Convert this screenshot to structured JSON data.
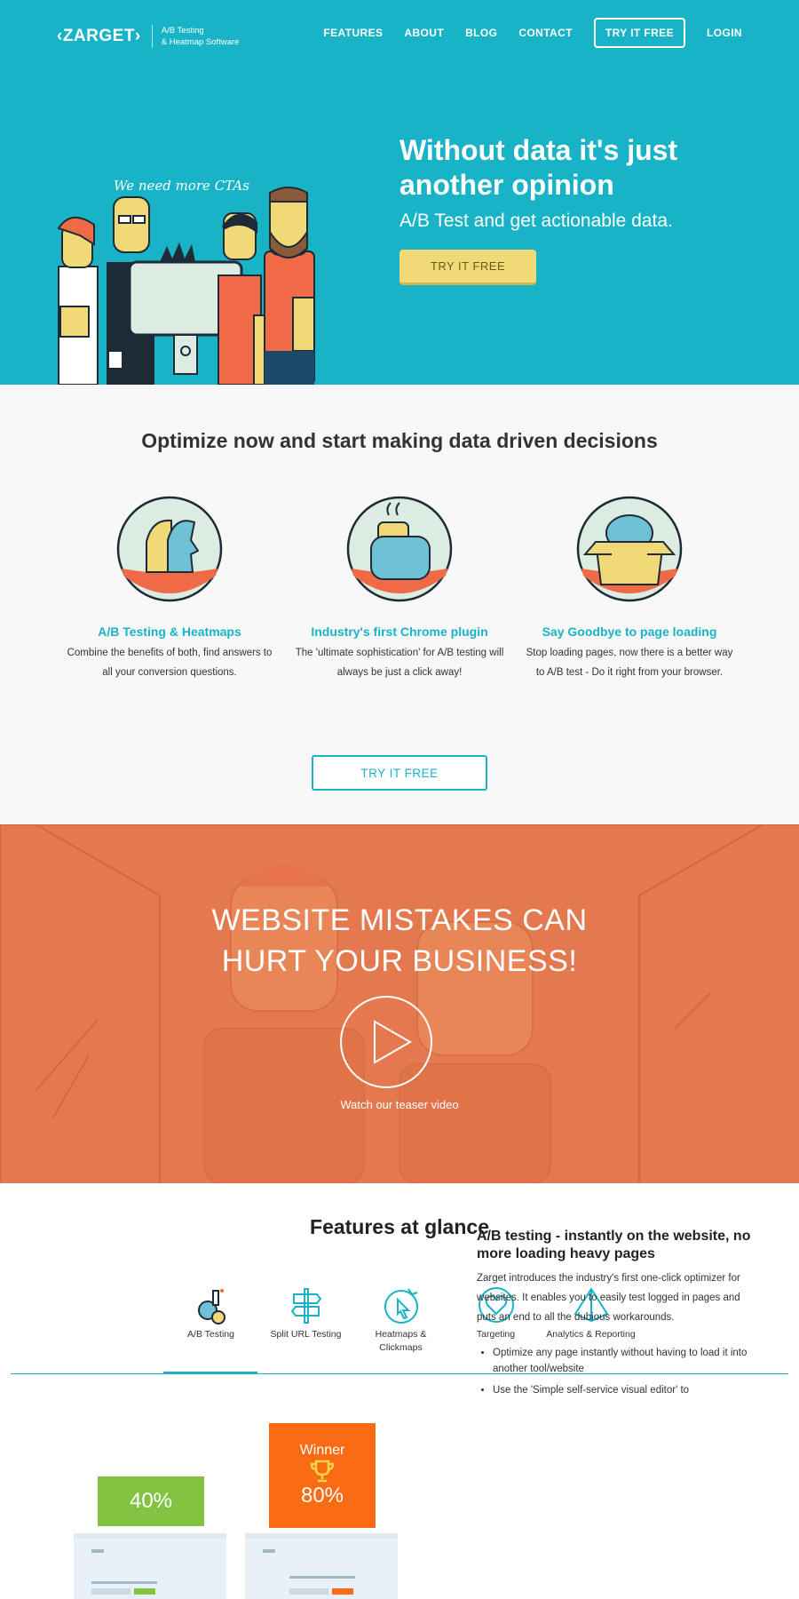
{
  "header": {
    "logo": "‹ZARGET›",
    "tagline_line1": "A/B Testing",
    "tagline_line2": "& Heatmap Software",
    "nav": [
      {
        "label": "FEATURES"
      },
      {
        "label": "ABOUT"
      },
      {
        "label": "BLOG"
      },
      {
        "label": "CONTACT"
      },
      {
        "label": "TRY IT FREE"
      },
      {
        "label": "LOGIN"
      }
    ]
  },
  "hero": {
    "title": "Without data it's just another opinion",
    "subtitle": "A/B Test and get actionable data.",
    "cta": "TRY IT FREE",
    "speech": "We need more CTAs"
  },
  "optimize": {
    "title": "Optimize now and start making data driven decisions",
    "features": [
      {
        "title": "A/B Testing & Heatmaps",
        "text": "Combine the benefits of both, find answers to all your conversion questions."
      },
      {
        "title": "Industry's first Chrome plugin",
        "text": "The 'ultimate sophistication' for A/B testing will always be just a click away!"
      },
      {
        "title": "Say Goodbye to page loading",
        "text": "Stop loading pages, now there is a better way to A/B test - Do it right from your browser."
      }
    ],
    "cta": "TRY IT FREE"
  },
  "video": {
    "title_line1": "WEBSITE MISTAKES CAN",
    "title_line2": "HURT YOUR BUSINESS!",
    "caption": "Watch our teaser video"
  },
  "features_glance": {
    "title": "Features at glance",
    "tabs": [
      {
        "label": "A/B Testing",
        "icon": "ab-testing-icon"
      },
      {
        "label": "Split URL Testing",
        "icon": "signpost-icon"
      },
      {
        "label": "Heatmaps & Clickmaps",
        "icon": "heatmap-cursor-icon"
      },
      {
        "label": "Targeting",
        "icon": "heart-target-icon"
      },
      {
        "label": "Analytics & Reporting",
        "icon": "pyramid-icon"
      }
    ],
    "active_tab": "A/B Testing",
    "variant_a": "40%",
    "variant_b": "80%",
    "winner_label": "Winner",
    "heading": "A/B testing - instantly on the website, no more loading heavy pages",
    "paragraph": "Zarget introduces the industry's first one-click optimizer for websites. It enables you to easily test logged in pages and puts an end to all the dubious workarounds.",
    "bullets": [
      "Optimize any page instantly without having to load it into another tool/website",
      "Use the 'Simple self-service visual editor' to"
    ]
  },
  "colors": {
    "primary": "#19b3c7",
    "cta_yellow": "#f2d977",
    "video_orange": "#e4784e",
    "winner_orange": "#fa6b14",
    "variant_green": "#82c341"
  }
}
